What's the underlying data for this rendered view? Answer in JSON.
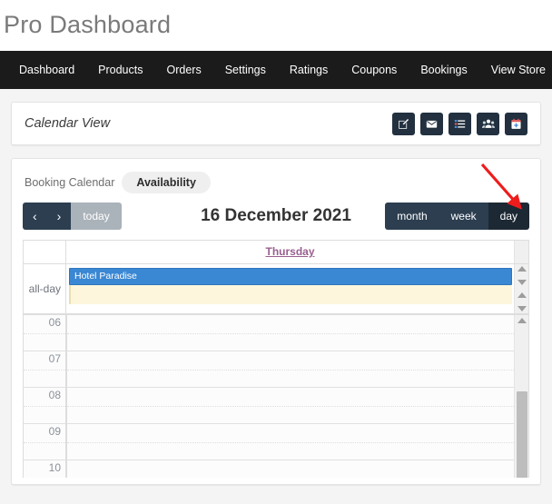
{
  "page": {
    "title": "Pro Dashboard"
  },
  "nav": {
    "items": [
      {
        "label": "Dashboard"
      },
      {
        "label": "Products"
      },
      {
        "label": "Orders"
      },
      {
        "label": "Settings"
      },
      {
        "label": "Ratings"
      },
      {
        "label": "Coupons"
      },
      {
        "label": "Bookings"
      },
      {
        "label": "View Store"
      }
    ]
  },
  "calendar_view_card": {
    "title": "Calendar View",
    "actions": [
      {
        "icon": "edit-square-icon",
        "name": "edit-button"
      },
      {
        "icon": "envelope-icon",
        "name": "message-button"
      },
      {
        "icon": "list-icon",
        "name": "list-button"
      },
      {
        "icon": "users-icon",
        "name": "customers-button"
      },
      {
        "icon": "calendar-plus-icon",
        "name": "add-booking-button"
      }
    ]
  },
  "calendar": {
    "tabs": [
      {
        "label": "Booking Calendar",
        "active": false
      },
      {
        "label": "Availability",
        "active": true
      }
    ],
    "nav": {
      "prev_label": "‹",
      "next_label": "›",
      "today_label": "today"
    },
    "heading": "16 December 2021",
    "views": [
      {
        "label": "month",
        "active": false
      },
      {
        "label": "week",
        "active": false
      },
      {
        "label": "day",
        "active": true
      }
    ],
    "day_header": "Thursday",
    "all_day_label": "all-day",
    "events": [
      {
        "title": "Hotel Paradise",
        "color": "#3a87d4"
      }
    ],
    "time_slots": [
      "06",
      "07",
      "08",
      "09",
      "10"
    ]
  },
  "colors": {
    "navbar_bg": "#1b1b1b",
    "button_dark": "#2c3e50",
    "button_active": "#1c2833",
    "button_disabled": "#aab2ba",
    "event_blue": "#3a87d4",
    "all_day_bg": "#fdf6dd",
    "day_link": "#9a5f8e",
    "annotation_red": "#ee1c1c"
  }
}
